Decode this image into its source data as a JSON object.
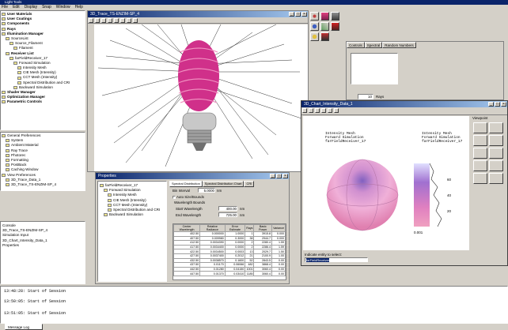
{
  "app": {
    "title": "Light Tools",
    "menu": [
      "File",
      "Edit",
      "Display",
      "Snap",
      "Window",
      "Help"
    ]
  },
  "left_tree": {
    "items": [
      {
        "label": "User Materials",
        "bold": true,
        "indent": 0
      },
      {
        "label": "User Coatings",
        "bold": true,
        "indent": 0
      },
      {
        "label": "Components",
        "bold": true,
        "indent": 0
      },
      {
        "label": "Rays",
        "bold": true,
        "indent": 0
      },
      {
        "label": "Illumination Manager",
        "bold": true,
        "indent": 0
      },
      {
        "label": "SourceList",
        "bold": false,
        "indent": 1
      },
      {
        "label": "Source_Filament",
        "bold": false,
        "indent": 2
      },
      {
        "label": "Filament",
        "bold": false,
        "indent": 3
      },
      {
        "label": "Receiver List",
        "bold": true,
        "indent": 1
      },
      {
        "label": "farFieldReceiver_17",
        "bold": false,
        "indent": 2
      },
      {
        "label": "Forward Simulation",
        "bold": false,
        "indent": 3
      },
      {
        "label": "Intensity Mesh",
        "bold": false,
        "indent": 4
      },
      {
        "label": "CIE Mesh (Intensity)",
        "bold": false,
        "indent": 4
      },
      {
        "label": "CCT Mesh (Intensity)",
        "bold": false,
        "indent": 4
      },
      {
        "label": "Spectral Distribution and CRI",
        "bold": false,
        "indent": 4
      },
      {
        "label": "Backward Simulation",
        "bold": false,
        "indent": 3
      },
      {
        "label": "Shader Manager",
        "bold": true,
        "indent": 0
      },
      {
        "label": "Optimization Manager",
        "bold": true,
        "indent": 0
      },
      {
        "label": "Parametric Controls",
        "bold": true,
        "indent": 0
      }
    ]
  },
  "prefs": {
    "items": [
      "General Preferences",
      "System",
      "Ambient Material",
      "Ray Trace",
      "Photorec",
      "Formatting",
      "PostBack",
      "Caching Window",
      "View Preferences",
      "3D_Trace_Data_1",
      "3D_Trace_TS-ENZIM-SP_4"
    ]
  },
  "windows_list": {
    "items": [
      "Console",
      "3D_Trace_TS-ENZIM-SP_4",
      "Simulation Input",
      "3D_Chart_Intensity_Data_1",
      "Properties"
    ]
  },
  "view3d": {
    "title": "3D_Trace_TS-ENZIM-SP_4"
  },
  "right_panel": {
    "tabs": [
      "Controls",
      "Spectral",
      "Random Numbers"
    ],
    "value": "10",
    "value_unit": "Rays"
  },
  "properties": {
    "title": "Properties",
    "tree": [
      {
        "label": "farFieldReceiver_17",
        "indent": 0
      },
      {
        "label": "Forward Simulation",
        "indent": 1
      },
      {
        "label": "Intensity Mesh",
        "indent": 2
      },
      {
        "label": "CIE Mesh (Intensity)",
        "indent": 2
      },
      {
        "label": "CCT Mesh (Intensity)",
        "indent": 2
      },
      {
        "label": "Spectral Distribution and CRI",
        "indent": 2
      },
      {
        "label": "Backward Simulation",
        "indent": 1
      }
    ],
    "tabs": [
      "Spectral Distribution",
      "Spectral Distribution Chart",
      "CRI"
    ],
    "bin_interval_label": "Bin Interval",
    "bin_interval_value": "5.0000",
    "bin_interval_unit": "nm",
    "auto_size_label": "Auto Size/Bounds",
    "wavelength_bounds_label": "Wavelength Bounds",
    "start_label": "Start Wavelength",
    "start_value": "400.00",
    "start_unit": "nm",
    "end_label": "End Wavelength",
    "end_value": "725.00",
    "end_unit": "nm",
    "table_headers": [
      "Center Wavelength",
      "Relative Radiance",
      "Error Estimate",
      "Rays",
      "Basic Power",
      "Variance"
    ],
    "table_rows": [
      [
        "402.50",
        "0.000000",
        "1.0000",
        "1",
        "3915.8",
        "0.000"
      ],
      [
        "407.50",
        "0.009980",
        "0.3000",
        "38",
        "2944.7",
        "0.000"
      ],
      [
        "412.50",
        "0.0034390",
        "0.0000",
        "2",
        "2280.4",
        "1.59"
      ],
      [
        "417.50",
        "0.0034400",
        "0.0000",
        "2",
        "2286.4",
        "1.59"
      ],
      [
        "422.50",
        "0.0034500",
        "0.0003",
        "13",
        "2029.7",
        "1.50"
      ],
      [
        "427.50",
        "0.0037400",
        "0.2012",
        "21",
        "2100.9",
        "1.00"
      ],
      [
        "432.50",
        "0.0038570",
        "0.1600",
        "52",
        "2843.5",
        "0.00"
      ],
      [
        "437.50",
        "0.01170",
        "0.06066",
        "482",
        "3868.4",
        "0.00"
      ],
      [
        "442.50",
        "0.01280",
        "0.04150",
        "1001",
        "3060.4",
        "0.00"
      ],
      [
        "447.50",
        "0.01370",
        "0.03410",
        "1185",
        "3060.4",
        "0.00"
      ]
    ]
  },
  "chart": {
    "title": "3D_Chart_Intensity_Data_1",
    "left_caption": [
      "Intensity Mesh",
      "Forward Simulation",
      "farFieldReceiver_17"
    ],
    "right_caption": [
      "Intensity Mesh",
      "Forward Simulation",
      "farFieldReceiver_17"
    ],
    "scale_labels": [
      "60",
      "40",
      "20"
    ],
    "scale_bottom": "0.001",
    "select_label": "Indicate entity to select:",
    "select_value": "farFieldReceiver",
    "viewpoint_label": "Viewpoint"
  },
  "console": {
    "lines": [
      "13:48:28: Start of Session",
      "13:50:05: Start of Session",
      "13:51:05: Start of Session"
    ],
    "tab": "Message Log"
  }
}
